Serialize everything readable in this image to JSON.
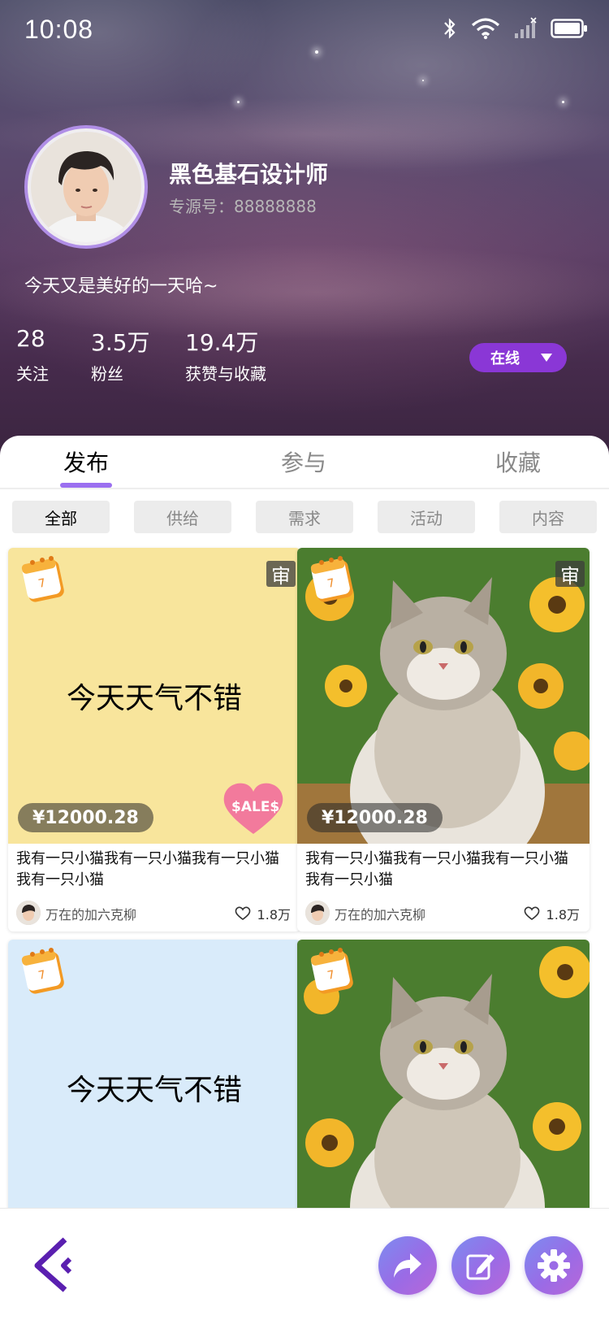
{
  "status_bar": {
    "time": "10:08"
  },
  "profile": {
    "nickname": "黑色基石设计师",
    "source_id": "专源号：88888888",
    "bio": "今天又是美好的一天哈~",
    "online_status": "在线",
    "stats": [
      {
        "value": "28",
        "label": "关注"
      },
      {
        "value": "3.5万",
        "label": "粉丝"
      },
      {
        "value": "19.4万",
        "label": "获赞与收藏"
      }
    ]
  },
  "tabs": [
    {
      "label": "发布",
      "active": true
    },
    {
      "label": "参与",
      "active": false
    },
    {
      "label": "收藏",
      "active": false
    }
  ],
  "filters": [
    {
      "label": "全部",
      "active": true
    },
    {
      "label": "供给",
      "active": false
    },
    {
      "label": "需求",
      "active": false
    },
    {
      "label": "活动",
      "active": false
    },
    {
      "label": "内容",
      "active": false
    }
  ],
  "cards": [
    {
      "image_text": "今天天气不错",
      "review_badge": "审",
      "price": "¥12000.28",
      "title": "我有一只小猫我有一只小猫我有一只小猫我有一只小猫",
      "author": "万在的加六克柳",
      "likes": "1.8万"
    },
    {
      "review_badge": "审",
      "price": "¥12000.28",
      "title": "我有一只小猫我有一只小猫我有一只小猫我有一只小猫",
      "author": "万在的加六克柳",
      "likes": "1.8万"
    },
    {
      "image_text": "今天天气不错"
    },
    {}
  ],
  "colors": {
    "accent_purple": "#8a37d6",
    "tab_active": "#010101",
    "tab_inactive": "#898989",
    "source_id": "#B7B7B7",
    "sales_heart": "#f27a9c"
  }
}
